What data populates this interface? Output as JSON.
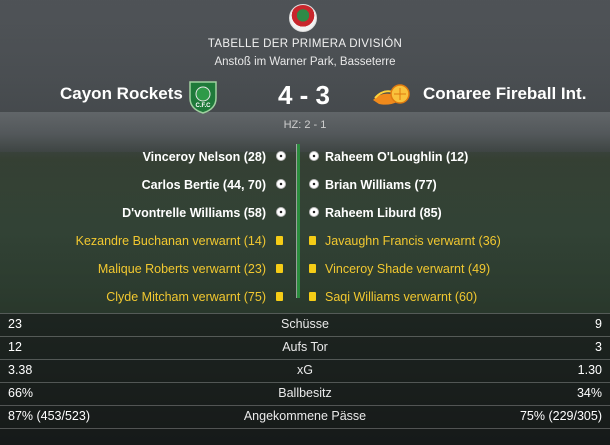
{
  "header": {
    "competition_logo": "primera-division-logo",
    "title": "TABELLE DER PRIMERA DIVISIÓN",
    "venue": "Anstoß im Warner Park, Basseterre"
  },
  "match": {
    "home_team": "Cayon Rockets",
    "away_team": "Conaree Fireball Int.",
    "home_badge_text": "C.F.C",
    "score": "4 - 3",
    "halftime": "HZ: 2 - 1"
  },
  "events": [
    {
      "type": "goal",
      "home": "Vinceroy Nelson (28)",
      "away": "Raheem O'Loughlin (12)"
    },
    {
      "type": "goal",
      "home": "Carlos Bertie (44, 70)",
      "away": "Brian Williams (77)"
    },
    {
      "type": "goal",
      "home": "D'vontrelle Williams (58)",
      "away": "Raheem Liburd (85)"
    },
    {
      "type": "card",
      "home": "Kezandre Buchanan verwarnt (14)",
      "away": "Javaughn Francis verwarnt (36)"
    },
    {
      "type": "card",
      "home": "Malique Roberts verwarnt (23)",
      "away": "Vinceroy Shade verwarnt (49)"
    },
    {
      "type": "card",
      "home": "Clyde Mitcham verwarnt (75)",
      "away": "Saqi Williams verwarnt (60)"
    }
  ],
  "stats": [
    {
      "home": "23",
      "label": "Schüsse",
      "away": "9"
    },
    {
      "home": "12",
      "label": "Aufs Tor",
      "away": "3"
    },
    {
      "home": "3.38",
      "label": "xG",
      "away": "1.30"
    },
    {
      "home": "66%",
      "label": "Ballbesitz",
      "away": "34%"
    },
    {
      "home": "87% (453/523)",
      "label": "Angekommene Pässe",
      "away": "75% (229/305)"
    }
  ],
  "colors": {
    "goal_text": "#ffffff",
    "card_text": "#f2c830",
    "yellow_card": "#f5cc16",
    "home_accent": "#2b8c3e"
  }
}
